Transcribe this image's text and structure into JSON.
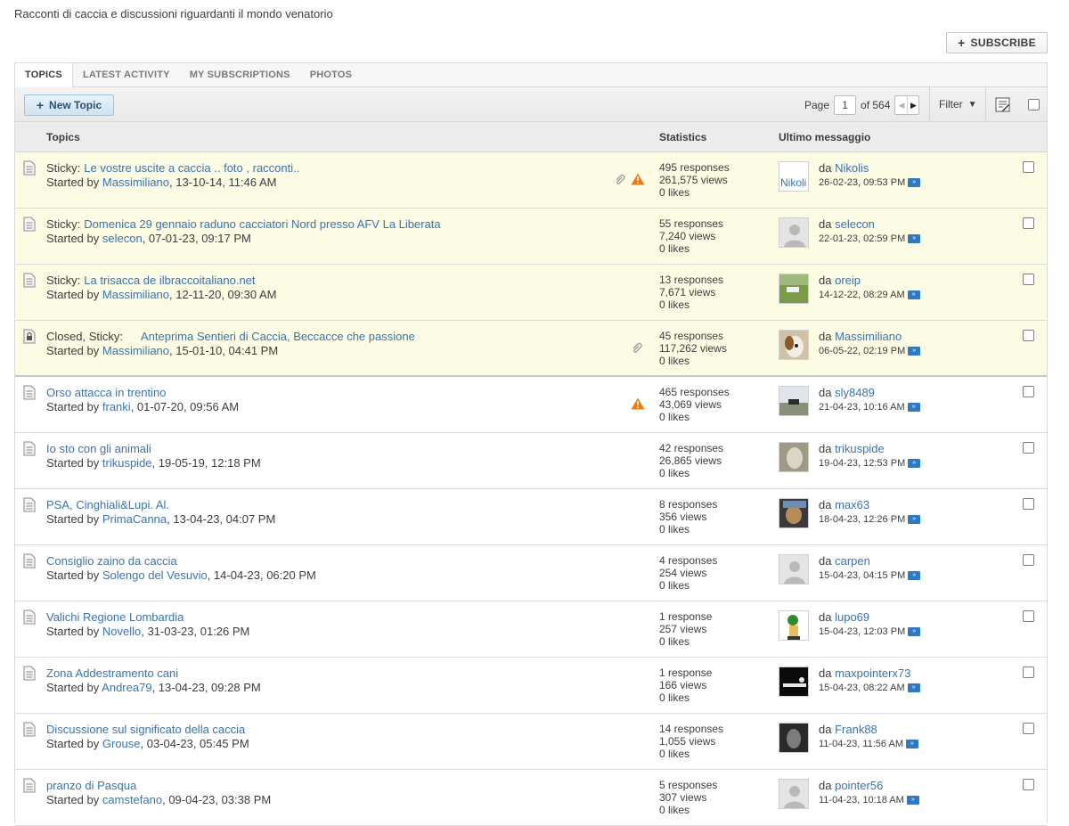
{
  "description": "Racconti di caccia e discussioni riguardanti il mondo venatorio",
  "subscribe": {
    "plus": "+",
    "label": "SUBSCRIBE"
  },
  "tabs": [
    "TOPICS",
    "LATEST ACTIVITY",
    "MY SUBSCRIPTIONS",
    "PHOTOS"
  ],
  "toolbar": {
    "new_topic_plus": "+",
    "new_topic": "New Topic",
    "page_label": "Page",
    "page_value": "1",
    "of_label": "of 564",
    "filter_label": "Filter"
  },
  "columns": {
    "topics": "Topics",
    "statistics": "Statistics",
    "last": "Ultimo messaggio"
  },
  "topics": [
    {
      "prefix": "Sticky:",
      "title": "Le vostre uscite a caccia .. foto , racconti..",
      "started": "Started by",
      "author": "Massimiliano",
      "date": ", 13-10-14, 11:46 AM",
      "responses": "495 responses",
      "views": "261,575 views",
      "likes": "0 likes",
      "da": "da",
      "last_user": "Nikolis",
      "last_date": "26-02-23, 09:53 PM",
      "avatar_text": "Nikoli",
      "goto": "»"
    },
    {
      "prefix": "Sticky:",
      "title": "Domenica 29 gennaio raduno cacciatori Nord presso AFV La Liberata",
      "started": "Started by",
      "author": "selecon",
      "date": ", 07-01-23, 09:17 PM",
      "responses": "55 responses",
      "views": "7,240 views",
      "likes": "0 likes",
      "da": "da",
      "last_user": "selecon",
      "last_date": "22-01-23, 02:59 PM",
      "goto": "»"
    },
    {
      "prefix": "Sticky:",
      "title": "La trisacca de ilbraccoitaliano.net",
      "started": "Started by",
      "author": "Massimiliano",
      "date": ", 12-11-20, 09:30 AM",
      "responses": "13 responses",
      "views": "7,671 views",
      "likes": "0 likes",
      "da": "da",
      "last_user": "oreip",
      "last_date": "14-12-22, 08:29 AM",
      "goto": "»"
    },
    {
      "prefix": "Closed, Sticky:",
      "title": "Anteprima Sentieri di Caccia, Beccacce che passione",
      "started": "Started by",
      "author": "Massimiliano",
      "date": ", 15-01-10, 04:41 PM",
      "responses": "45 responses",
      "views": "117,262 views",
      "likes": "0 likes",
      "da": "da",
      "last_user": "Massimiliano",
      "last_date": "06-05-22, 02:19 PM",
      "goto": "»"
    },
    {
      "prefix": "",
      "title": "Orso attacca in trentino",
      "started": "Started by",
      "author": "franki",
      "date": ", 01-07-20, 09:56 AM",
      "responses": "465 responses",
      "views": "43,069 views",
      "likes": "0 likes",
      "da": "da",
      "last_user": "sly8489",
      "last_date": "21-04-23, 10:16 AM",
      "goto": "»"
    },
    {
      "prefix": "",
      "title": "Io sto con gli animali",
      "started": "Started by",
      "author": "trikuspide",
      "date": ", 19-05-19, 12:18 PM",
      "responses": "42 responses",
      "views": "26,865 views",
      "likes": "0 likes",
      "da": "da",
      "last_user": "trikuspide",
      "last_date": "19-04-23, 12:53 PM",
      "goto": "»"
    },
    {
      "prefix": "",
      "title": "PSA, Cinghiali&Lupi. Al.",
      "started": "Started by",
      "author": "PrimaCanna",
      "date": ", 13-04-23, 04:07 PM",
      "responses": "8 responses",
      "views": "356 views",
      "likes": "0 likes",
      "da": "da",
      "last_user": "max63",
      "last_date": "18-04-23, 12:26 PM",
      "goto": "»"
    },
    {
      "prefix": "",
      "title": "Consiglio zaino da caccia",
      "started": "Started by",
      "author": "Solengo del Vesuvio",
      "date": ", 14-04-23, 06:20 PM",
      "responses": "4 responses",
      "views": "254 views",
      "likes": "0 likes",
      "da": "da",
      "last_user": "carpen",
      "last_date": "15-04-23, 04:15 PM",
      "goto": "»"
    },
    {
      "prefix": "",
      "title": "Valichi Regione Lombardia",
      "started": "Started by",
      "author": "Novello",
      "date": ", 31-03-23, 01:26 PM",
      "responses": "1 response",
      "views": "257 views",
      "likes": "0 likes",
      "da": "da",
      "last_user": "lupo69",
      "last_date": "15-04-23, 12:03 PM",
      "goto": "»"
    },
    {
      "prefix": "",
      "title": "Zona Addestramento cani",
      "started": "Started by",
      "author": "Andrea79",
      "date": ", 13-04-23, 09:28 PM",
      "responses": "1 response",
      "views": "166 views",
      "likes": "0 likes",
      "da": "da",
      "last_user": "maxpointerx73",
      "last_date": "15-04-23, 08:22 AM",
      "goto": "»"
    },
    {
      "prefix": "",
      "title": "Discussione sul significato della caccia",
      "started": "Started by",
      "author": "Grouse",
      "date": ", 03-04-23, 05:45 PM",
      "responses": "14 responses",
      "views": "1,055 views",
      "likes": "0 likes",
      "da": "da",
      "last_user": "Frank88",
      "last_date": "11-04-23, 11:56 AM",
      "goto": "»"
    },
    {
      "prefix": "",
      "title": "pranzo di Pasqua",
      "started": "Started by",
      "author": "camstefano",
      "date": ", 09-04-23, 03:38 PM",
      "responses": "5 responses",
      "views": "307 views",
      "likes": "0 likes",
      "da": "da",
      "last_user": "pointer56",
      "last_date": "11-04-23, 10:18 AM",
      "goto": "»"
    }
  ]
}
